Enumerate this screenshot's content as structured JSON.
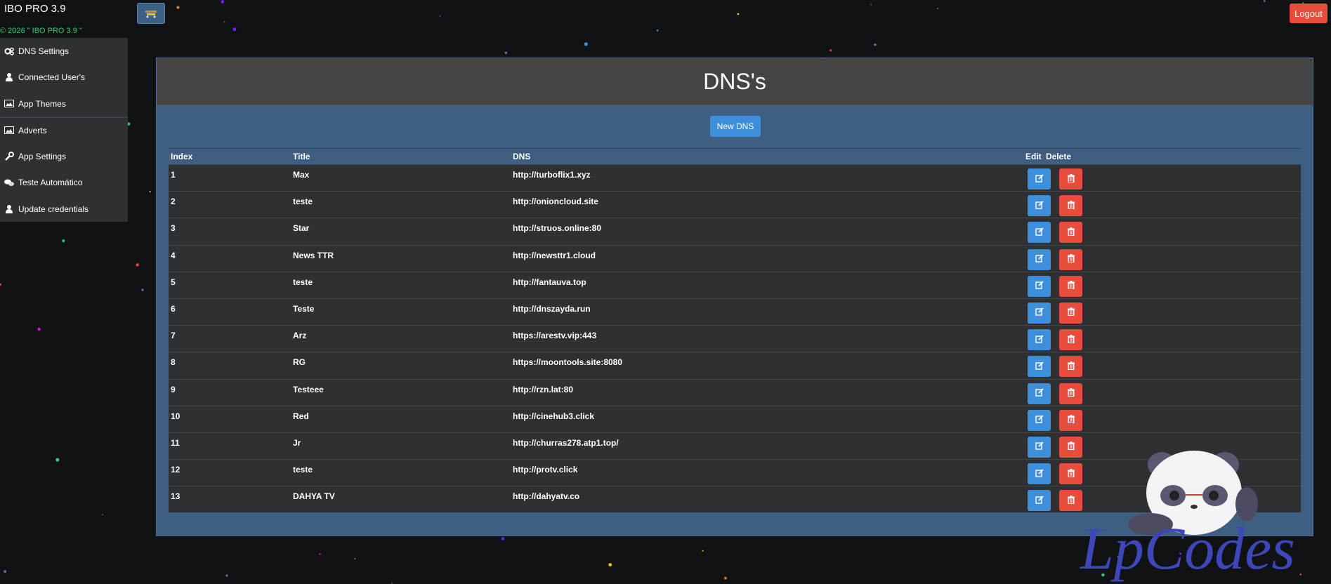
{
  "app": {
    "brand": "IBO PRO 3.9",
    "copyright": "© 2026 \" IBO PRO 3.9 \"",
    "logout_label": "Logout"
  },
  "sidebar": {
    "items": [
      {
        "label": "DNS Settings",
        "icon": "gears-icon"
      },
      {
        "label": "Connected User's",
        "icon": "user-icon"
      },
      {
        "label": "App Themes",
        "icon": "image-icon"
      },
      {
        "label": "Adverts",
        "icon": "image-icon"
      },
      {
        "label": "App Settings",
        "icon": "wrench-icon"
      },
      {
        "label": "Teste Automático",
        "icon": "comments-icon"
      },
      {
        "label": "Update credentials",
        "icon": "user-icon"
      }
    ]
  },
  "main": {
    "title": "DNS's",
    "new_button": "New DNS",
    "columns": {
      "index": "Index",
      "title": "Title",
      "dns": "DNS",
      "edit": "Edit",
      "delete": "Delete"
    },
    "rows": [
      {
        "index": "1",
        "title": "Max",
        "dns": "http://turboflix1.xyz"
      },
      {
        "index": "2",
        "title": "teste",
        "dns": "http://onioncloud.site"
      },
      {
        "index": "3",
        "title": "Star",
        "dns": "http://struos.online:80"
      },
      {
        "index": "4",
        "title": "News TTR",
        "dns": "http://newsttr1.cloud"
      },
      {
        "index": "5",
        "title": "teste",
        "dns": "http://fantauva.top"
      },
      {
        "index": "6",
        "title": "Teste",
        "dns": "http://dnszayda.run"
      },
      {
        "index": "7",
        "title": "Arz",
        "dns": "https://arestv.vip:443"
      },
      {
        "index": "8",
        "title": "RG",
        "dns": "https://moontools.site:8080"
      },
      {
        "index": "9",
        "title": "Testeee",
        "dns": "http://rzn.lat:80"
      },
      {
        "index": "10",
        "title": "Red",
        "dns": "http://cinehub3.click"
      },
      {
        "index": "11",
        "title": "Jr",
        "dns": "http://churras278.atp1.top/"
      },
      {
        "index": "12",
        "title": "teste",
        "dns": "http://protv.click"
      },
      {
        "index": "13",
        "title": "DAHYA TV",
        "dns": "http://dahyatv.co"
      }
    ]
  },
  "watermark": {
    "text": "LpCodes"
  },
  "colors": {
    "accent": "#3d8edb",
    "danger": "#e74c3c",
    "panel": "#3e5e82",
    "background": "#111214"
  }
}
